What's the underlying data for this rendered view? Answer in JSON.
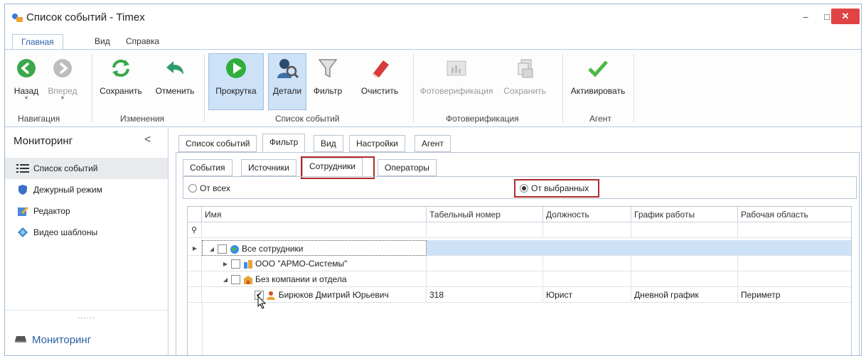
{
  "window": {
    "title": "Список событий - Timex",
    "min_glyph": "–",
    "max_glyph": "□",
    "close_glyph": "✕"
  },
  "ribbon": {
    "tabs": [
      "Главная",
      "Вид",
      "Справка"
    ],
    "buttons": {
      "back": "Назад",
      "forward": "Вперед",
      "save": "Сохранить",
      "cancel": "Отменить",
      "scroll": "Прокрутка",
      "details": "Детали",
      "filter": "Фильтр",
      "clear": "Очистить",
      "photo": "Фотоверификация",
      "photo_save": "Сохранить",
      "activate": "Активировать"
    },
    "groups": {
      "navigation": "Навигация",
      "changes": "Изменения",
      "events": "Список событий",
      "photo": "Фотоверификация",
      "agent": "Агент"
    }
  },
  "left": {
    "title": "Мониторинг",
    "collapse": "<",
    "items": [
      "Список событий",
      "Дежурный режим",
      "Редактор",
      "Видео шаблоны"
    ],
    "dots": "......",
    "bottom": "Мониторинг"
  },
  "main_tabs": [
    "Список событий",
    "Фильтр",
    "Вид",
    "Настройки",
    "Агент"
  ],
  "filter_tabs": [
    "События",
    "Источники",
    "Сотрудники",
    "Операторы"
  ],
  "radios": {
    "all": "От всех",
    "selected": "От выбранных"
  },
  "grid": {
    "columns": [
      "Имя",
      "Табельный номер",
      "Должность",
      "График работы",
      "Рабочая область"
    ],
    "filter_row_icon": "⚲",
    "rows": [
      {
        "name": "Все сотрудники",
        "number": "",
        "position": "",
        "schedule": "",
        "area": ""
      },
      {
        "name": "ООО \"АРМО-Системы\"",
        "number": "",
        "position": "",
        "schedule": "",
        "area": ""
      },
      {
        "name": "Без компании и отдела",
        "number": "",
        "position": "",
        "schedule": "",
        "area": ""
      },
      {
        "name": "Бирюков Дмитрий Юрьевич",
        "number": "318",
        "position": "Юрист",
        "schedule": "Дневной график",
        "area": "Периметр"
      }
    ]
  },
  "colors": {
    "accent": "#2a5fa6",
    "highlight_row": "#cde2f6",
    "annotation": "#b22a2a",
    "close": "#e04343"
  }
}
